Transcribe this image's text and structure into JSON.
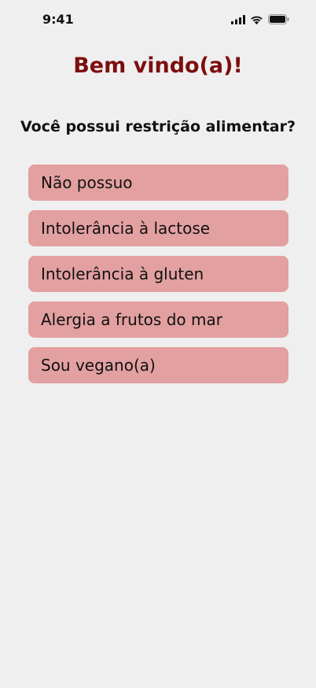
{
  "status_bar": {
    "time": "9:41",
    "icons": [
      "signal-icon",
      "wifi-icon",
      "battery-icon"
    ]
  },
  "screen": {
    "title": "Bem vindo(a)!",
    "question": "Você possui restrição alimentar?",
    "options": [
      {
        "label": "Não possuo"
      },
      {
        "label": "Intolerância à lactose"
      },
      {
        "label": "Intolerância à gluten"
      },
      {
        "label": "Alergia a frutos do mar"
      },
      {
        "label": "Sou vegano(a)"
      }
    ]
  },
  "colors": {
    "background": "#efefef",
    "title": "#7d0e0e",
    "option_background": "#e3a0a0",
    "text": "#111111"
  }
}
